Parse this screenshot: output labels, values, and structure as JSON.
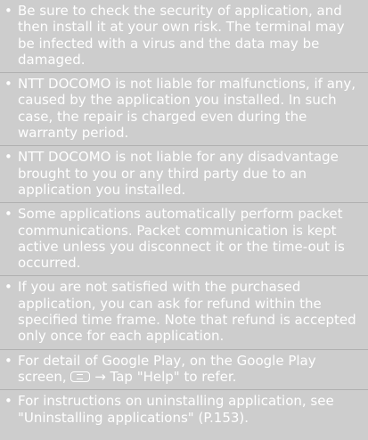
{
  "notes": [
    "Be sure to check the security of application, and then install it at your own risk. The terminal may be infected with a virus and the data may be damaged.",
    "NTT DOCOMO is not liable for malfunctions, if any, caused by the application you installed. In such case, the repair is charged even during the warranty period.",
    "NTT DOCOMO is not liable for any disadvantage brought to you or any third party due to an application you installed.",
    "Some applications automatically perform packet communications. Packet communication is kept active unless you disconnect it or the time-out is occurred.",
    "If you are not satisfied with the purchased application, you can ask for refund within the specified time frame. Note that refund is accepted only once for each application.",
    {
      "before": "For detail of Google Play, on the Google Play screen,",
      "icon": "menu-key-icon",
      "after": "→ Tap \"Help\" to refer."
    },
    "For instructions on uninstalling application, see \"Uninstalling applications\" (P.153)."
  ]
}
